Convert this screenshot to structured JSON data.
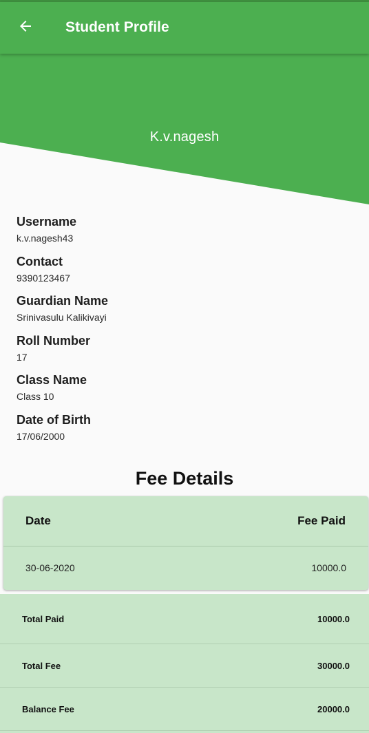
{
  "appbar": {
    "title": "Student Profile",
    "back_icon": "arrow-left-icon"
  },
  "colors": {
    "primary": "#4caf50",
    "table_bg": "#c8e6c9",
    "background": "#fafafa"
  },
  "profile": {
    "name": "K.v.nagesh"
  },
  "info": [
    {
      "label": "Username",
      "value": "k.v.nagesh43"
    },
    {
      "label": "Contact",
      "value": "9390123467"
    },
    {
      "label": "Guardian Name",
      "value": "Srinivasulu Kalikivayi"
    },
    {
      "label": "Roll Number",
      "value": "17"
    },
    {
      "label": "Class Name",
      "value": "Class 10"
    },
    {
      "label": "Date of Birth",
      "value": "17/06/2000"
    }
  ],
  "fee_details": {
    "heading": "Fee Details",
    "columns": [
      "Date",
      "Fee Paid"
    ],
    "rows": [
      {
        "date": "30-06-2020",
        "fee_paid": "10000.0"
      }
    ]
  },
  "summary": [
    {
      "label": "Total Paid",
      "value": "10000.0"
    },
    {
      "label": "Total Fee",
      "value": "30000.0"
    },
    {
      "label": "Balance Fee",
      "value": "20000.0"
    }
  ]
}
